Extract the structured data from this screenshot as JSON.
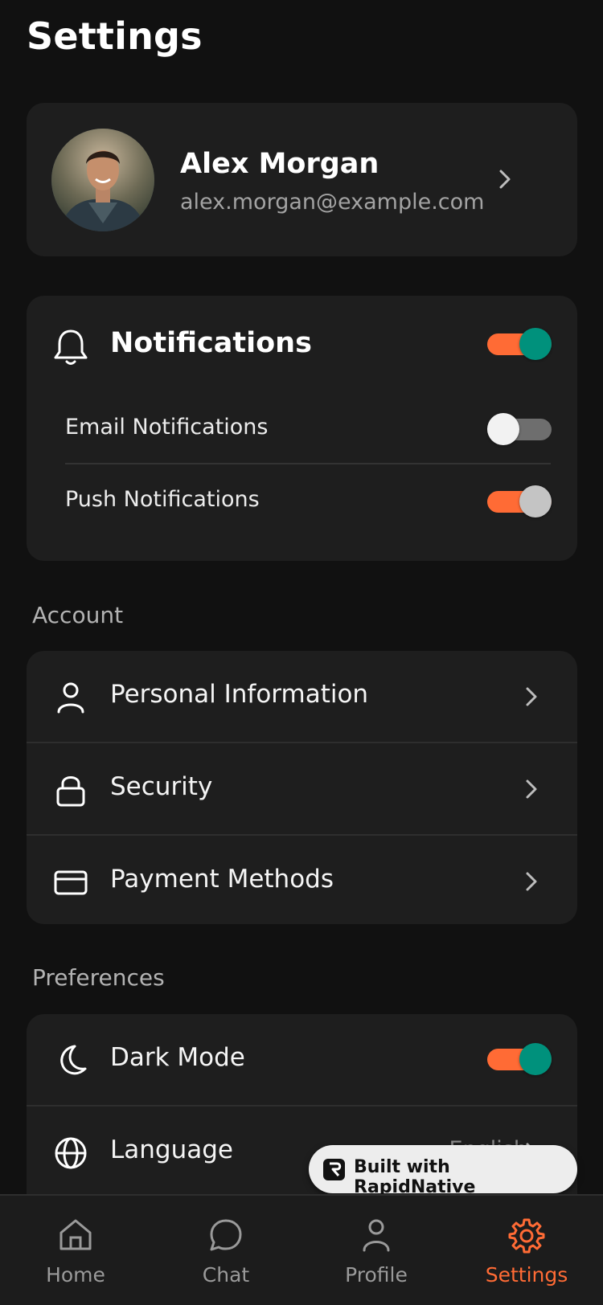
{
  "page": {
    "title": "Settings"
  },
  "profile": {
    "name": "Alex Morgan",
    "email": "alex.morgan@example.com"
  },
  "notifications": {
    "title": "Notifications",
    "master_on": true,
    "items": [
      {
        "label": "Email Notifications",
        "on": false
      },
      {
        "label": "Push Notifications",
        "on": true
      }
    ]
  },
  "account": {
    "section_label": "Account",
    "items": [
      {
        "label": "Personal Information",
        "icon": "user-icon"
      },
      {
        "label": "Security",
        "icon": "lock-icon"
      },
      {
        "label": "Payment Methods",
        "icon": "credit-card-icon"
      }
    ]
  },
  "preferences": {
    "section_label": "Preferences",
    "dark_mode": {
      "label": "Dark Mode",
      "icon": "moon-icon",
      "on": true
    },
    "language": {
      "label": "Language",
      "icon": "globe-icon",
      "value": "English"
    }
  },
  "badge": {
    "text": "Built with RapidNative"
  },
  "tabs": [
    {
      "label": "Home",
      "icon": "home-icon",
      "active": false
    },
    {
      "label": "Chat",
      "icon": "chat-icon",
      "active": false
    },
    {
      "label": "Profile",
      "icon": "profile-icon",
      "active": false
    },
    {
      "label": "Settings",
      "icon": "gear-icon",
      "active": true
    }
  ],
  "colors": {
    "accent": "#ff6b35",
    "toggle_thumb_on": "#00917c",
    "background": "#111111",
    "card": "#1e1e1e"
  }
}
